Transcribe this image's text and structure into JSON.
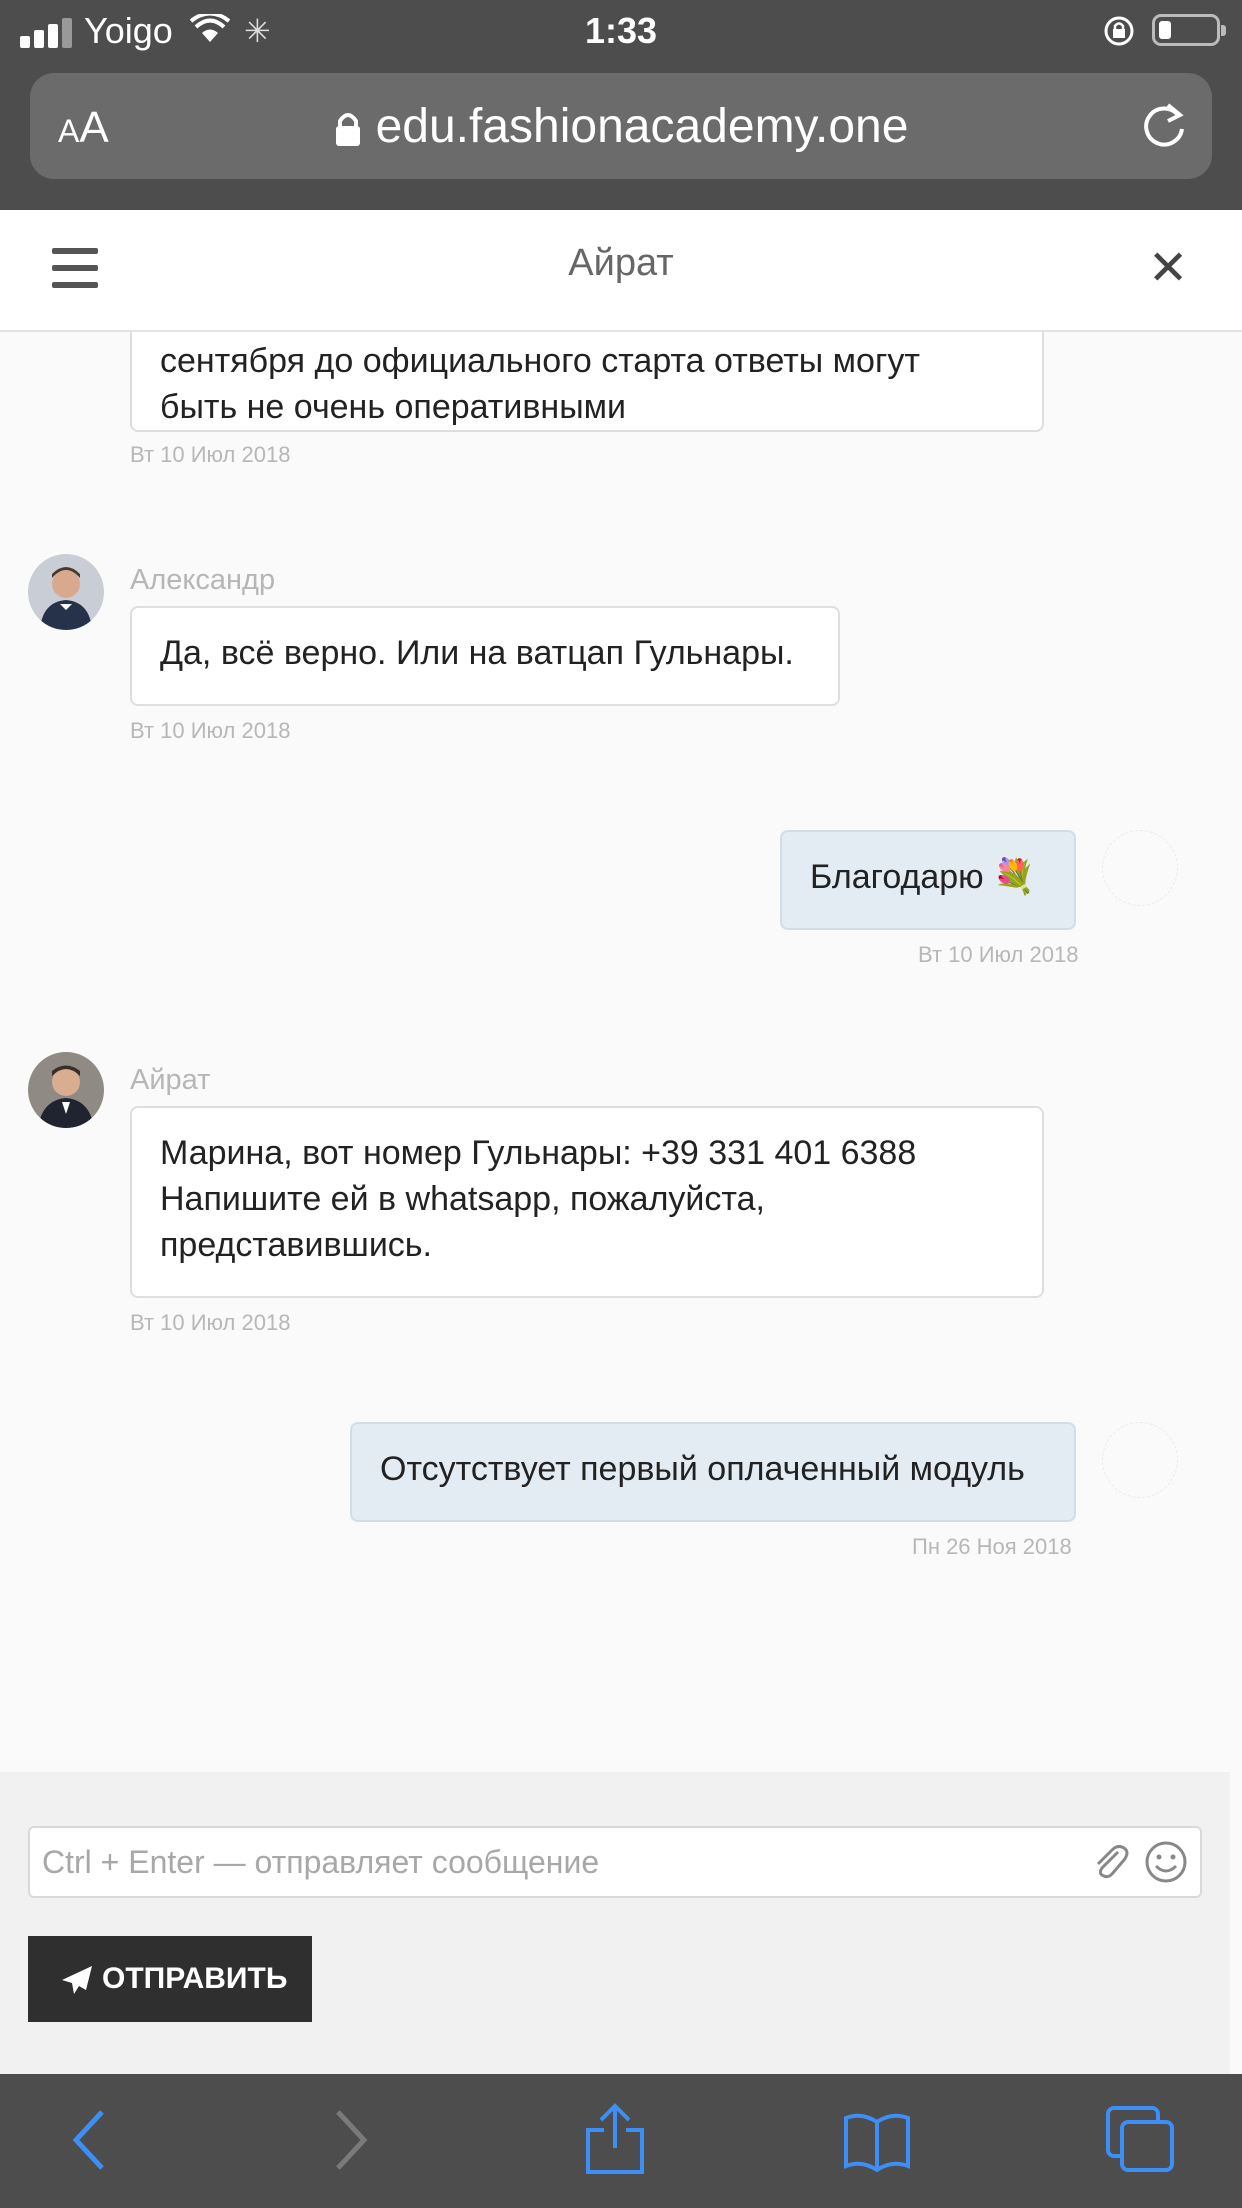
{
  "status": {
    "carrier": "Yoigo",
    "time": "1:33"
  },
  "browser": {
    "text_size_label": "AA",
    "url": "edu.fashionacademy.one"
  },
  "chat": {
    "title": "Айрат",
    "messages": [
      {
        "sender": "",
        "text": "сентября до официального старта ответы могут\nбыть не очень оперативными",
        "date": "Вт 10 Июл 2018",
        "own": false
      },
      {
        "sender": "Александр",
        "text": "Да, всё верно. Или на ватцап Гульнары.",
        "date": "Вт 10 Июл 2018",
        "own": false
      },
      {
        "sender": "",
        "text": "Благодарю 💐",
        "date": "Вт 10 Июл 2018",
        "own": true
      },
      {
        "sender": "Айрат",
        "text": "Марина, вот номер Гульнары: +39 331 401 6388\nНапишите ей в whatsapp, пожалуйста,\nпредставившись.",
        "date": "Вт 10 Июл 2018",
        "own": false
      },
      {
        "sender": "",
        "text": "Отсутствует первый оплаченный модуль",
        "date": "Пн 26 Ноя 2018",
        "own": true
      }
    ]
  },
  "composer": {
    "placeholder": "Ctrl + Enter — отправляет сообщение",
    "value": "",
    "send_label": "ОТПРАВИТЬ"
  },
  "colors": {
    "own_bubble": "#e3ecf3",
    "browser_chrome": "#4d4d4d",
    "toolbar_icon": "#3d8ef5"
  }
}
